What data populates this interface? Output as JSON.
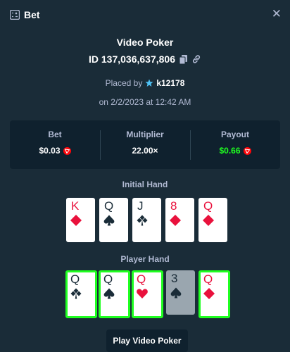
{
  "header": {
    "title": "Bet",
    "icon": "bet-slip-icon",
    "close_icon": "close-icon",
    "close_glyph": "✕"
  },
  "bet_info": {
    "game": "Video Poker",
    "id_label": "ID 137,036,637,806",
    "placed_by_label": "Placed by",
    "username": "k12178",
    "date": "on 2/2/2023 at 12:42 AM"
  },
  "stats": {
    "bet_label": "Bet",
    "bet_value": "$0.03",
    "multiplier_label": "Multiplier",
    "multiplier_value": "22.00×",
    "payout_label": "Payout",
    "payout_value": "$0.66",
    "currency_icon": "tron-coin-icon",
    "payout_color": "#1fff20"
  },
  "initial_hand": {
    "label": "Initial Hand",
    "cards": [
      {
        "rank": "K",
        "suit": "diamonds"
      },
      {
        "rank": "Q",
        "suit": "spades"
      },
      {
        "rank": "J",
        "suit": "clubs"
      },
      {
        "rank": "8",
        "suit": "diamonds"
      },
      {
        "rank": "Q",
        "suit": "diamonds"
      }
    ]
  },
  "player_hand": {
    "label": "Player Hand",
    "cards": [
      {
        "rank": "Q",
        "suit": "clubs",
        "held": true
      },
      {
        "rank": "Q",
        "suit": "spades",
        "held": true
      },
      {
        "rank": "Q",
        "suit": "hearts",
        "held": true
      },
      {
        "rank": "3",
        "suit": "spades",
        "held": false
      },
      {
        "rank": "Q",
        "suit": "diamonds",
        "held": true
      }
    ]
  },
  "play_button": "Play Video Poker"
}
